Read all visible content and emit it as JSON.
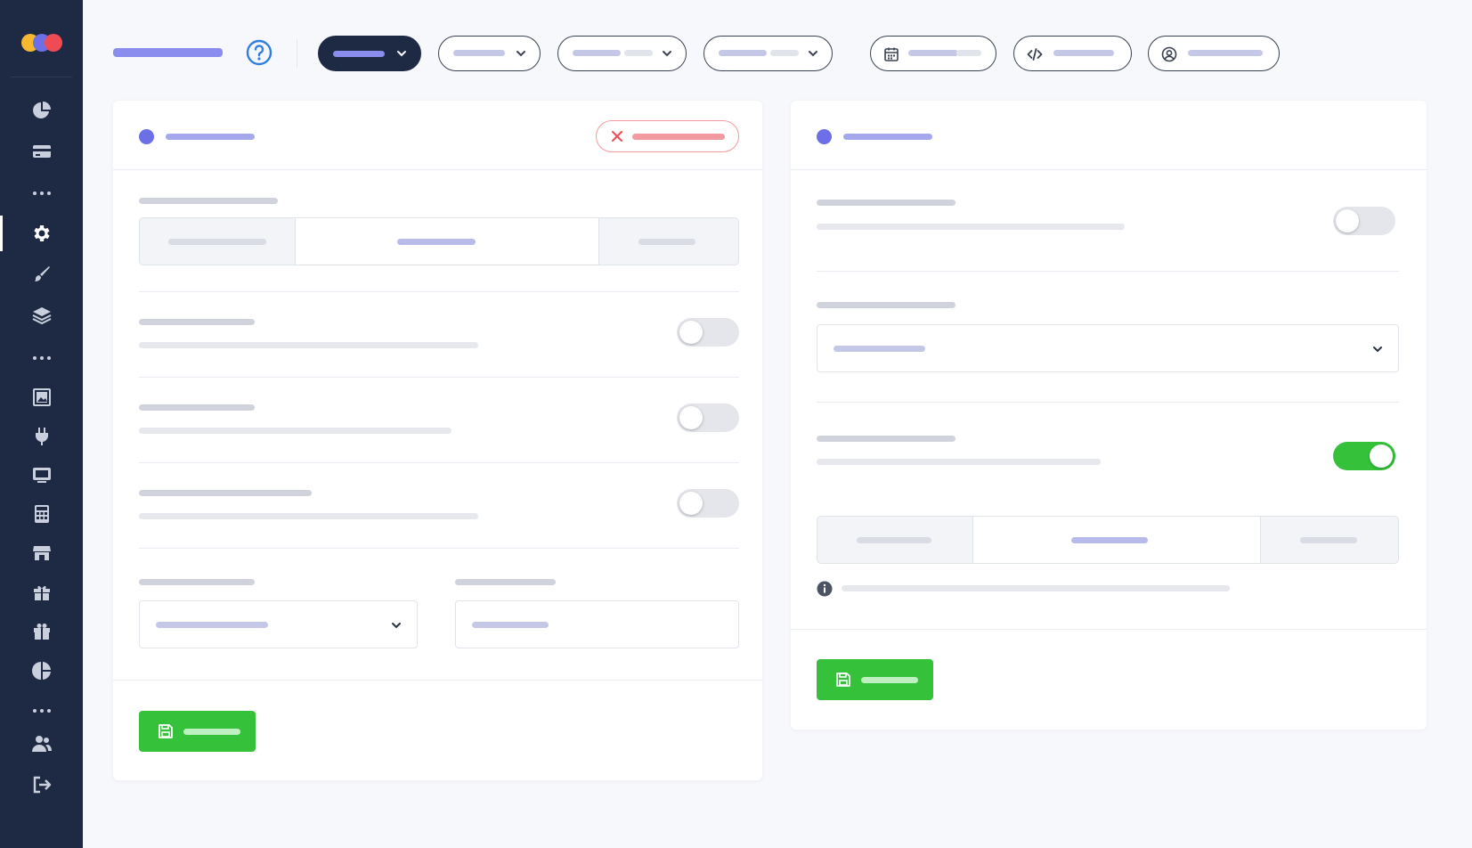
{
  "theme": {
    "sidebar_bg": "#1e2a44",
    "accent": "#6c6fe6",
    "success": "#35c23a",
    "danger": "#ef4b55",
    "placeholder_bar": "#d7dae3",
    "placeholder_accent": "#a6a8ee"
  },
  "logo": {
    "circles": [
      "#f5b82e",
      "#6c6fe6",
      "#ef4b55"
    ]
  },
  "sidebar": {
    "items": [
      {
        "icon": "pie-chart-icon"
      },
      {
        "icon": "credit-card-icon"
      },
      {
        "icon": "more-dots-icon"
      },
      {
        "icon": "gear-icon",
        "active": true
      },
      {
        "icon": "brush-icon"
      },
      {
        "icon": "layers-icon"
      },
      {
        "icon": "more-dots-icon"
      },
      {
        "icon": "image-frame-icon"
      },
      {
        "icon": "plug-icon"
      },
      {
        "icon": "monitor-icon"
      },
      {
        "icon": "calculator-icon"
      },
      {
        "icon": "store-icon"
      },
      {
        "icon": "gift-box-icon"
      },
      {
        "icon": "gift-icon"
      },
      {
        "icon": "pie-segment-icon"
      },
      {
        "icon": "more-dots-icon"
      },
      {
        "icon": "users-icon"
      },
      {
        "icon": "logout-icon"
      }
    ]
  },
  "topbar": {
    "help_icon": "question-circle-icon",
    "filters": [
      {
        "icon": "chevron-down-icon",
        "selected": true
      },
      {
        "icon": "chevron-down-icon"
      },
      {
        "icon": "chevron-down-icon"
      },
      {
        "icon": "chevron-down-icon"
      }
    ],
    "actions": [
      {
        "icon": "calendar-icon"
      },
      {
        "icon": "code-icon"
      },
      {
        "icon": "user-circle-icon"
      }
    ]
  },
  "left_card": {
    "toggles": [
      {
        "on": false
      },
      {
        "on": false
      },
      {
        "on": false
      }
    ],
    "segmented_selected_index": 1,
    "discard_icon": "close-icon",
    "save_icon": "save-icon"
  },
  "right_card": {
    "toggles": [
      {
        "on": false
      },
      {
        "on": true
      }
    ],
    "segmented_selected_index": 1,
    "info_icon": "info-icon",
    "save_icon": "save-icon"
  }
}
